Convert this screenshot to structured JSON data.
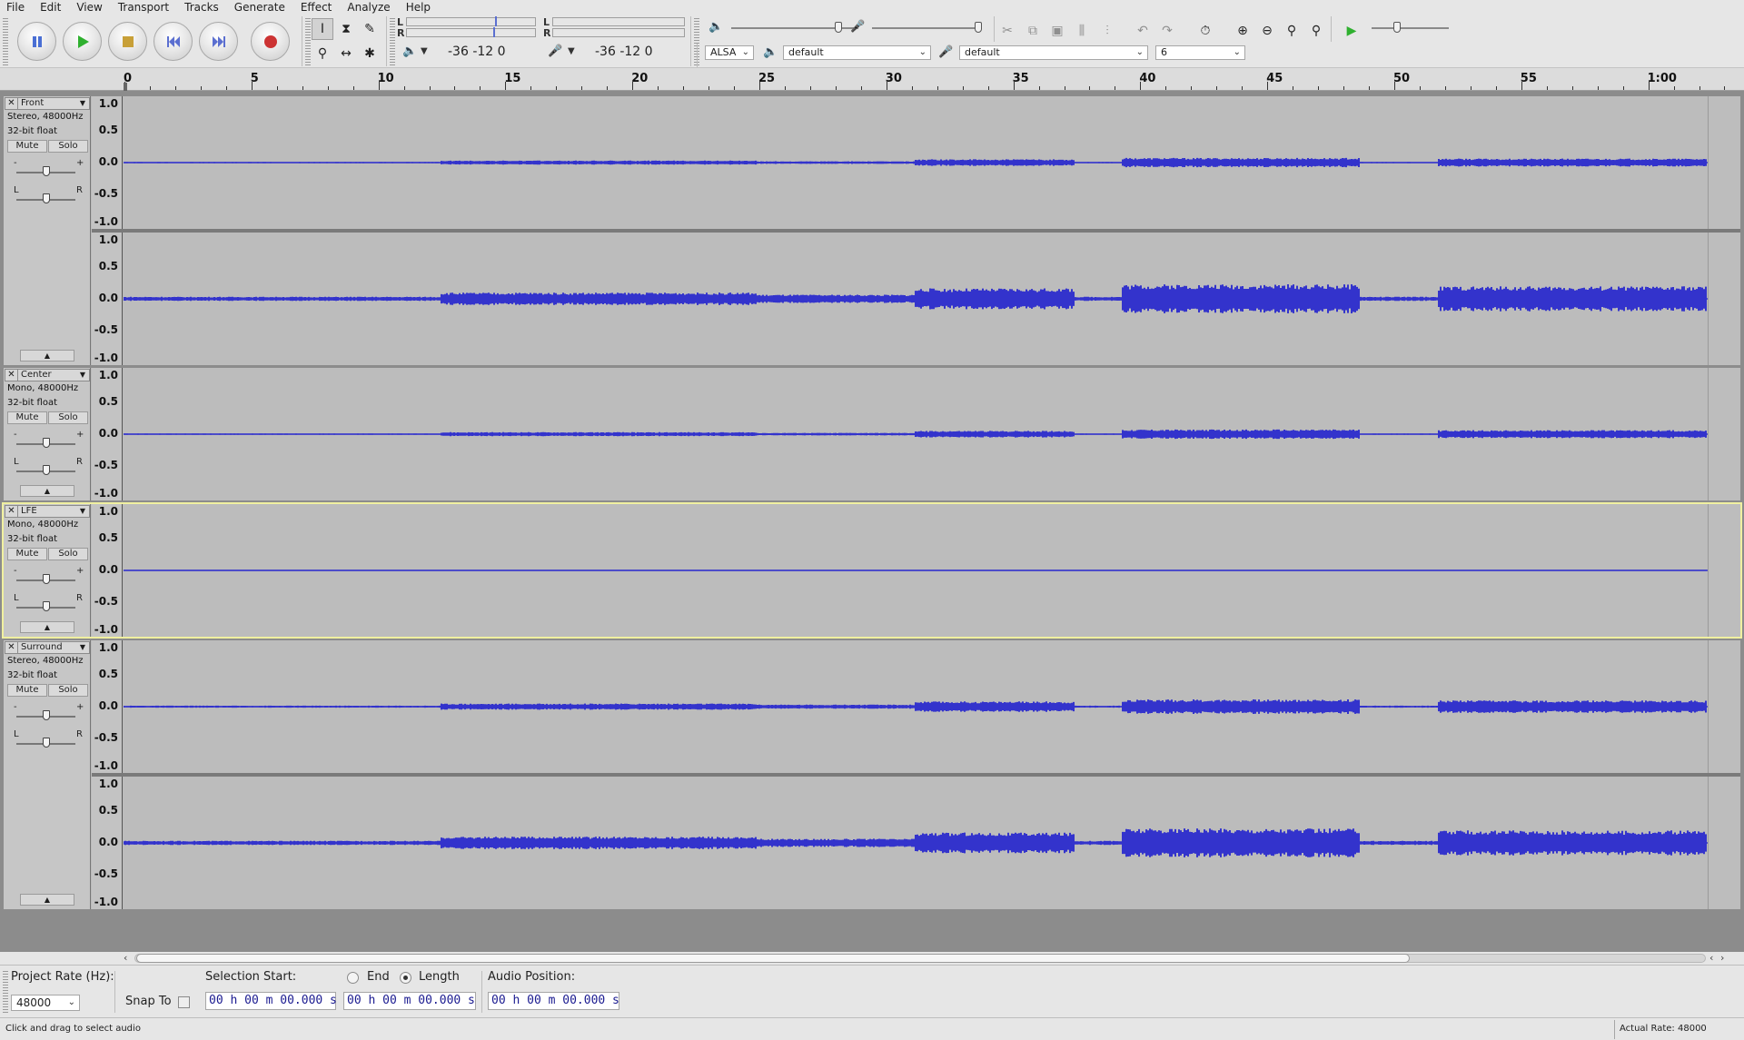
{
  "menu": [
    "File",
    "Edit",
    "View",
    "Transport",
    "Tracks",
    "Generate",
    "Effect",
    "Analyze",
    "Help"
  ],
  "transport": {
    "pause": "pause-icon",
    "play": "play-icon",
    "stop": "stop-icon",
    "skip_start": "skip-start-icon",
    "skip_end": "skip-end-icon",
    "record": "record-icon"
  },
  "meters": {
    "playback_scale": "-36  -12 0",
    "record_scale": "-36  -12 0",
    "left_label": "L",
    "right_label": "R"
  },
  "device": {
    "host": "ALSA",
    "output": "default",
    "input": "default",
    "channels": "6"
  },
  "ruler": {
    "labels": [
      "0",
      "5",
      "10",
      "15",
      "20",
      "25",
      "30",
      "35",
      "40",
      "45",
      "50",
      "55",
      "1:00"
    ]
  },
  "vruler": {
    "labels": [
      "1.0",
      "0.5",
      "0.0",
      "-0.5",
      "-1.0"
    ]
  },
  "tracks": [
    {
      "name": "Front",
      "format": "Stereo, 48000Hz",
      "bitdepth": "32-bit float",
      "mute": "Mute",
      "solo": "Solo",
      "selected": false
    },
    {
      "name": "Center",
      "format": "Mono, 48000Hz",
      "bitdepth": "32-bit float",
      "mute": "Mute",
      "solo": "Solo",
      "selected": false
    },
    {
      "name": "LFE",
      "format": "Mono, 48000Hz",
      "bitdepth": "32-bit float",
      "mute": "Mute",
      "solo": "Solo",
      "selected": true
    },
    {
      "name": "Surround",
      "format": "Stereo, 48000Hz",
      "bitdepth": "32-bit float",
      "mute": "Mute",
      "solo": "Solo",
      "selected": false
    }
  ],
  "gain_pan": {
    "minus": "-",
    "plus": "+",
    "left": "L",
    "right": "R"
  },
  "bottom": {
    "project_rate_label": "Project Rate (Hz):",
    "project_rate_value": "48000",
    "snap_to_label": "Snap To",
    "selection_start_label": "Selection Start:",
    "end_label": "End",
    "length_label": "Length",
    "audio_position_label": "Audio Position:",
    "selection_start_value": "00 h 00 m 00.000 s",
    "length_value": "00 h 00 m 00.000 s",
    "audio_position_value": "00 h 00 m 00.000 s"
  },
  "status": {
    "message": "Click and drag to select audio",
    "actual_rate": "Actual Rate: 48000"
  },
  "colors": {
    "waveform": "#3333cc",
    "background": "#bcbcbc",
    "selected_outline": "#f0f0a0"
  }
}
